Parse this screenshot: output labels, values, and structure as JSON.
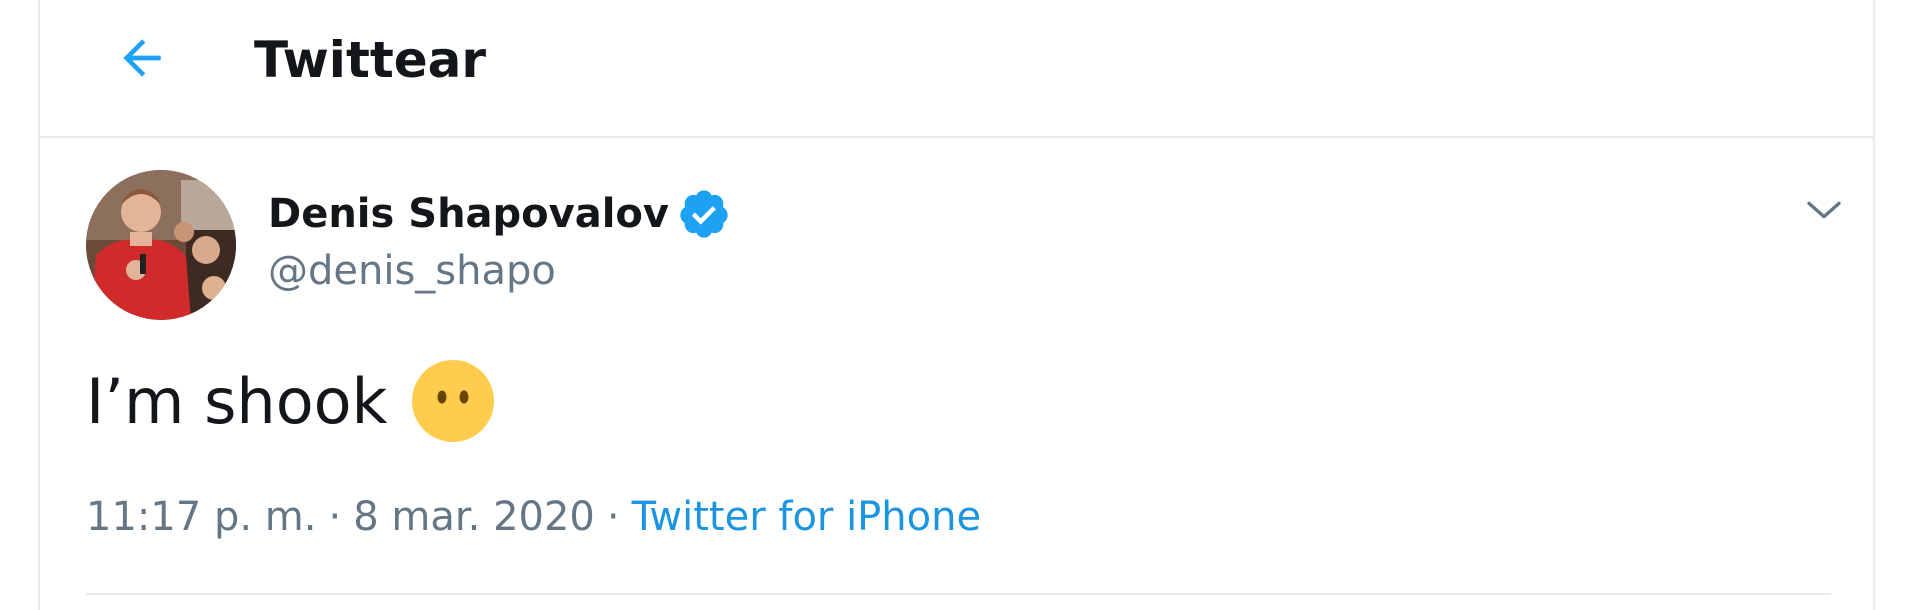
{
  "header": {
    "back_icon": "arrow-left-icon",
    "title": "Twittear"
  },
  "tweet": {
    "author": {
      "display_name": "Denis Shapovalov",
      "handle": "@denis_shapo",
      "verified": true,
      "verified_icon": "verified-badge-icon"
    },
    "menu_icon": "chevron-down-icon",
    "text": "I’m shook",
    "emoji": "face-without-mouth-emoji",
    "time": "11:17 p. m.",
    "separator": "·",
    "date": "8 mar. 2020",
    "source": "Twitter for iPhone"
  },
  "colors": {
    "accent": "#1da1f2",
    "link": "#1b95e0",
    "secondary_text": "#657786",
    "primary_text": "#14171a",
    "border": "#e6ecf0",
    "emoji_yellow": "#ffcc4d"
  }
}
